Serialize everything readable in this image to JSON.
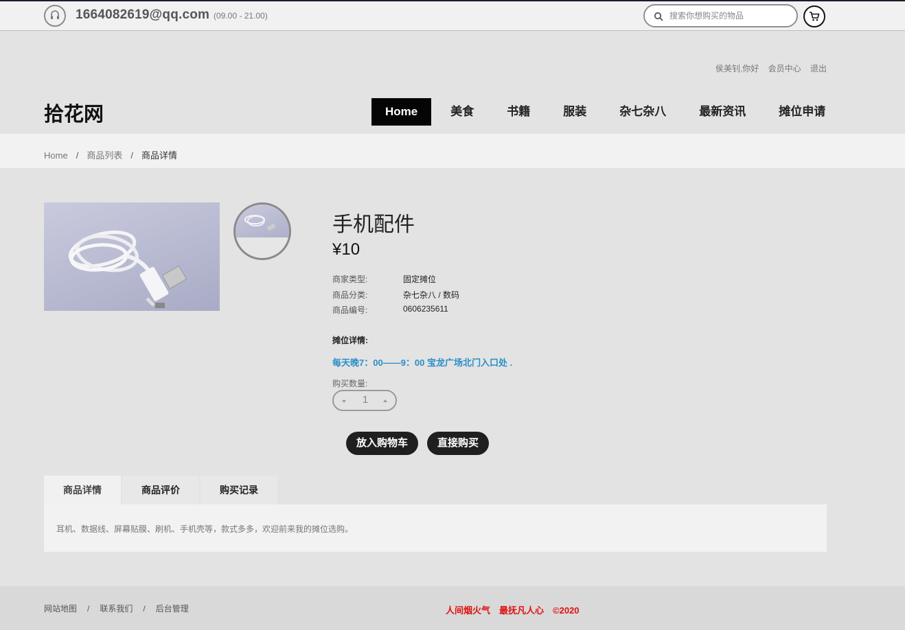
{
  "topbar": {
    "email": "1664082619@qq.com",
    "hours": "(09.00 - 21.00)",
    "search_placeholder": "搜索你想购买的物品"
  },
  "user_links": {
    "greeting": "侯美钊,你好",
    "member_center": "会员中心",
    "logout": "退出"
  },
  "logo": "拾花网",
  "nav": [
    "Home",
    "美食",
    "书籍",
    "服装",
    "杂七杂八",
    "最新资讯",
    "摊位申请"
  ],
  "breadcrumb": {
    "home": "Home",
    "list": "商品列表",
    "current": "商品详情",
    "separator": "/"
  },
  "product": {
    "title": "手机配件",
    "price": "¥10",
    "attributes": [
      {
        "label": "商家类型:",
        "value": "固定摊位"
      },
      {
        "label": "商品分类:",
        "value": "杂七杂八 / 数码"
      },
      {
        "label": "商品编号:",
        "value": "0606235611"
      }
    ],
    "stall_label": "摊位详情:",
    "stall_text": "每天晚7：00——9：00 宝龙广场北门入口处 .",
    "quantity_label": "购买数量:",
    "quantity": "1",
    "add_to_cart": "放入购物车",
    "buy_now": "直接购买"
  },
  "tabs": [
    "商品详情",
    "商品评价",
    "购买记录"
  ],
  "tab_content": "耳机、数据线、屏幕贴膜、刷机、手机壳等，款式多多，欢迎前来我的摊位选购。",
  "footer": {
    "links": [
      "网站地图",
      "联系我们",
      "后台管理"
    ],
    "separator": "/",
    "slogan": [
      "人间烟火气",
      "最抚凡人心",
      "©2020"
    ]
  },
  "colors": {
    "accent_blue": "#2a8ec8",
    "slogan_red": "#e01010",
    "nav_active_bg": "#050505"
  }
}
